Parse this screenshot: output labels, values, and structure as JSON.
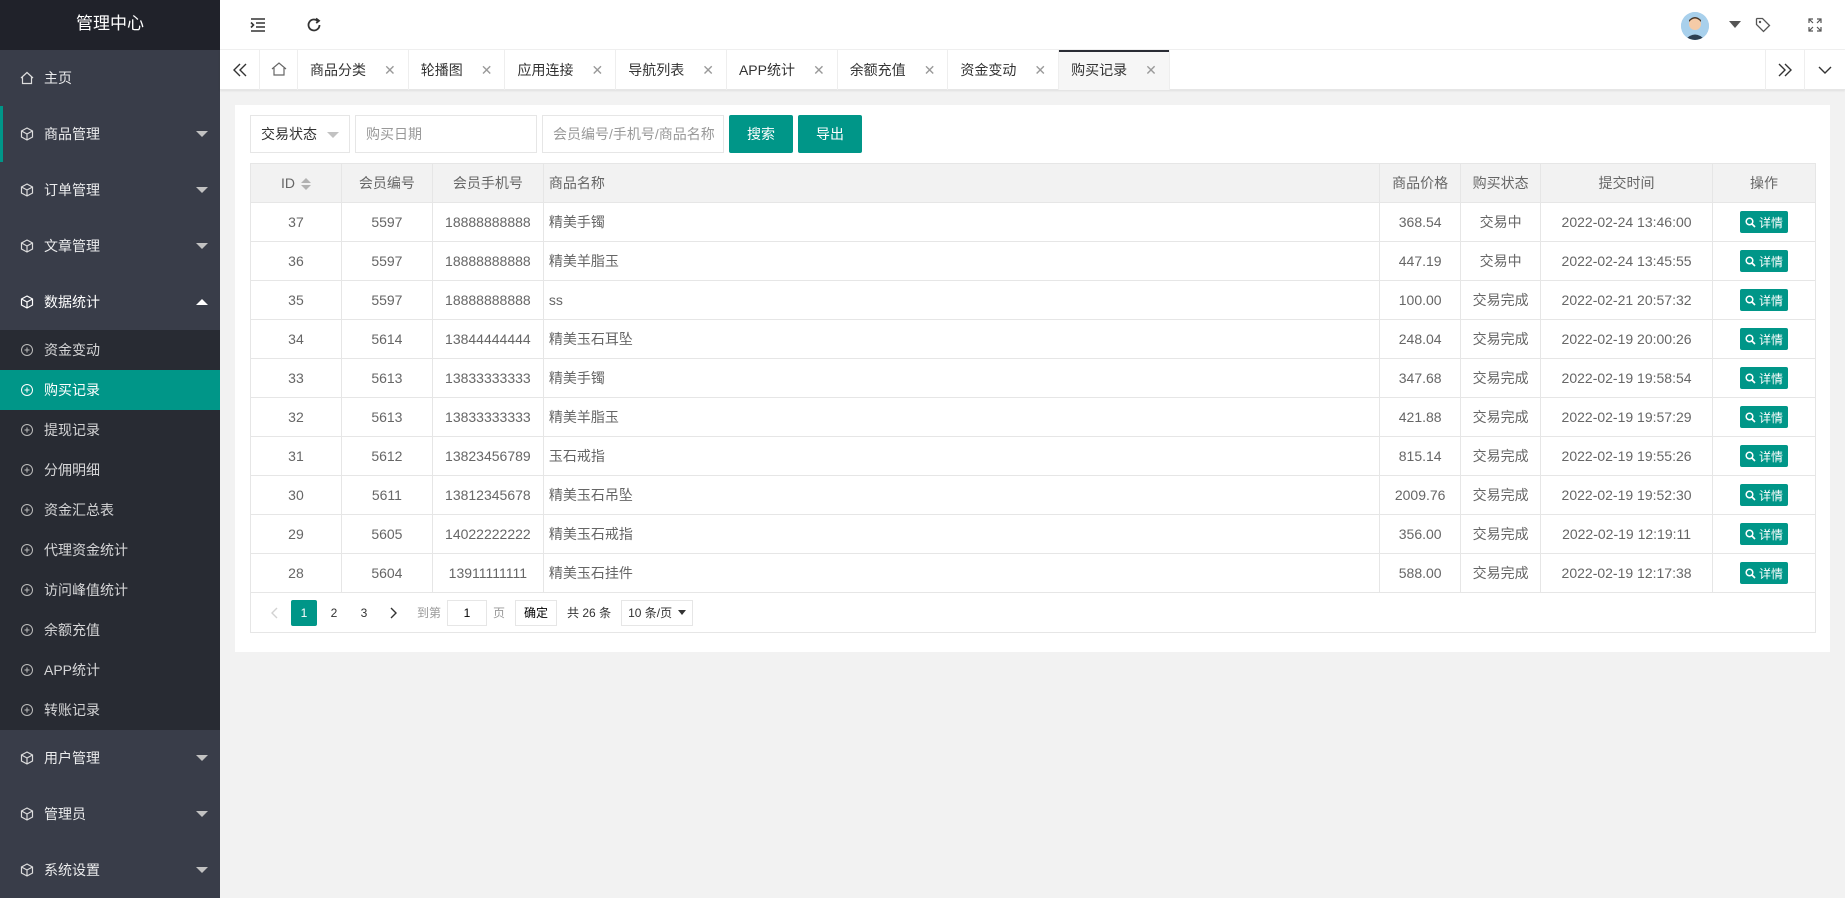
{
  "sidebar": {
    "title": "管理中心",
    "items": [
      {
        "label": "主页",
        "icon": "home-icon"
      },
      {
        "label": "商品管理",
        "icon": "cube-icon"
      },
      {
        "label": "订单管理",
        "icon": "cube-icon"
      },
      {
        "label": "文章管理",
        "icon": "cube-icon"
      },
      {
        "label": "数据统计",
        "icon": "cube-icon"
      },
      {
        "label": "用户管理",
        "icon": "cube-icon"
      },
      {
        "label": "管理员",
        "icon": "cube-icon"
      },
      {
        "label": "系统设置",
        "icon": "cube-icon"
      }
    ],
    "sub_items": [
      "资金变动",
      "购买记录",
      "提现记录",
      "分佣明细",
      "资金汇总表",
      "代理资金统计",
      "访问峰值统计",
      "余额充值",
      "APP统计",
      "转账记录"
    ]
  },
  "tabs": [
    "商品分类",
    "轮播图",
    "应用连接",
    "导航列表",
    "APP统计",
    "余额充值",
    "资金变动",
    "购买记录"
  ],
  "tab_close": "✕",
  "toolbar": {
    "status_select": "交易状态",
    "date_placeholder": "购买日期",
    "keyword_placeholder": "会员编号/手机号/商品名称",
    "search_label": "搜索",
    "export_label": "导出"
  },
  "table": {
    "headers": [
      "ID",
      "会员编号",
      "会员手机号",
      "商品名称",
      "商品价格",
      "购买状态",
      "提交时间",
      "操作"
    ],
    "detail_label": "详情",
    "rows": [
      {
        "id": "37",
        "member": "5597",
        "phone": "18888888888",
        "product": "精美手镯",
        "price": "368.54",
        "status": "交易中",
        "time": "2022-02-24 13:46:00"
      },
      {
        "id": "36",
        "member": "5597",
        "phone": "18888888888",
        "product": "精美羊脂玉",
        "price": "447.19",
        "status": "交易中",
        "time": "2022-02-24 13:45:55"
      },
      {
        "id": "35",
        "member": "5597",
        "phone": "18888888888",
        "product": "ss",
        "price": "100.00",
        "status": "交易完成",
        "time": "2022-02-21 20:57:32"
      },
      {
        "id": "34",
        "member": "5614",
        "phone": "13844444444",
        "product": "精美玉石耳坠",
        "price": "248.04",
        "status": "交易完成",
        "time": "2022-02-19 20:00:26"
      },
      {
        "id": "33",
        "member": "5613",
        "phone": "13833333333",
        "product": "精美手镯",
        "price": "347.68",
        "status": "交易完成",
        "time": "2022-02-19 19:58:54"
      },
      {
        "id": "32",
        "member": "5613",
        "phone": "13833333333",
        "product": "精美羊脂玉",
        "price": "421.88",
        "status": "交易完成",
        "time": "2022-02-19 19:57:29"
      },
      {
        "id": "31",
        "member": "5612",
        "phone": "13823456789",
        "product": "玉石戒指",
        "price": "815.14",
        "status": "交易完成",
        "time": "2022-02-19 19:55:26"
      },
      {
        "id": "30",
        "member": "5611",
        "phone": "13812345678",
        "product": "精美玉石吊坠",
        "price": "2009.76",
        "status": "交易完成",
        "time": "2022-02-19 19:52:30"
      },
      {
        "id": "29",
        "member": "5605",
        "phone": "14022222222",
        "product": "精美玉石戒指",
        "price": "356.00",
        "status": "交易完成",
        "time": "2022-02-19 12:19:11"
      },
      {
        "id": "28",
        "member": "5604",
        "phone": "13911111111",
        "product": "精美玉石挂件",
        "price": "588.00",
        "status": "交易完成",
        "time": "2022-02-19 12:17:38"
      }
    ]
  },
  "pager": {
    "pages": [
      "1",
      "2",
      "3"
    ],
    "goto_label": "到第",
    "goto_value": "1",
    "page_unit": "页",
    "confirm_label": "确定",
    "total_label": "共 26 条",
    "page_size": "10 条/页"
  },
  "colors": {
    "accent": "#009688",
    "sidebar": "#393d49",
    "sidebar_dark": "#282b33"
  }
}
